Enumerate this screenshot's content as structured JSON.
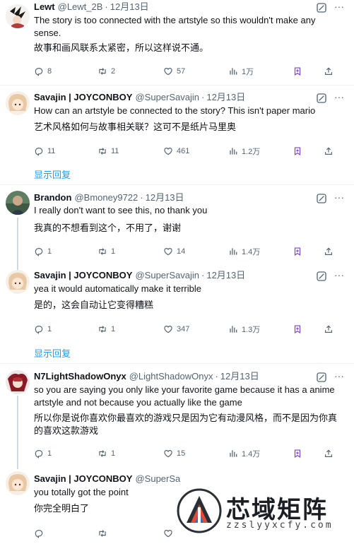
{
  "tweets": [
    {
      "name": "Lewt",
      "handle": "@Lewt_2B",
      "dot": "·",
      "time": "12月13日",
      "text": "The story is too connected with the artstyle so this wouldn't make any sense.",
      "translation": "故事和画风联系太紧密，所以这样说不通。",
      "replies": "8",
      "retweets": "2",
      "likes": "57",
      "views": "1万",
      "show_replies": ""
    },
    {
      "name": "Savajin | JOYCONBOY",
      "handle": "@SuperSavajin",
      "dot": "·",
      "time": "12月13日",
      "text": "How can an artstyle be connected to the story? This isn't paper mario",
      "translation": "艺术风格如何与故事相关联？这可不是纸片马里奥",
      "replies": "11",
      "retweets": "11",
      "likes": "461",
      "views": "1.2万",
      "show_replies": "显示回复"
    },
    {
      "name": "Brandon",
      "handle": "@Bmoney9722",
      "dot": "·",
      "time": "12月13日",
      "text": "I really don't want to see this, no thank you",
      "translation": "我真的不想看到这个，不用了，谢谢",
      "replies": "1",
      "retweets": "1",
      "likes": "14",
      "views": "1.4万",
      "show_replies": ""
    },
    {
      "name": "Savajin | JOYCONBOY",
      "handle": "@SuperSavajin",
      "dot": "·",
      "time": "12月13日",
      "text": "yea it would automatically make it terrible",
      "translation": "是的，这会自动让它变得糟糕",
      "replies": "1",
      "retweets": "1",
      "likes": "347",
      "views": "1.3万",
      "show_replies": "显示回复"
    },
    {
      "name": "N7LightShadowOnyx",
      "handle": "@LightShadowOnyx",
      "dot": "·",
      "time": "12月13日",
      "text": "so you are saying you only like your favorite game because it has a anime artstyle and not because you actually like the game",
      "translation": "所以你是说你喜欢你最喜欢的游戏只是因为它有动漫风格，而不是因为你真的喜欢这款游戏",
      "replies": "1",
      "retweets": "1",
      "likes": "15",
      "views": "1.4万",
      "show_replies": ""
    },
    {
      "name": "Savajin | JOYCONBOY",
      "handle": "@SuperSa",
      "dot": "",
      "time": "",
      "text": "you totally got the point",
      "translation": "你完全明白了",
      "replies": "",
      "retweets": "",
      "likes": "",
      "views": "",
      "show_replies": ""
    }
  ],
  "watermark": {
    "title": "芯域矩阵",
    "url": "zzslyyxcfy.com"
  },
  "colors": {
    "text": "#0f1419",
    "secondary": "#536471",
    "link": "#1d9bf0",
    "bookmark": "#7b3fd1",
    "divider": "#eff3f4"
  },
  "icons": [
    "grok-icon",
    "more-icon",
    "reply-icon",
    "retweet-icon",
    "like-icon",
    "views-icon",
    "bookmark-icon",
    "share-icon"
  ]
}
